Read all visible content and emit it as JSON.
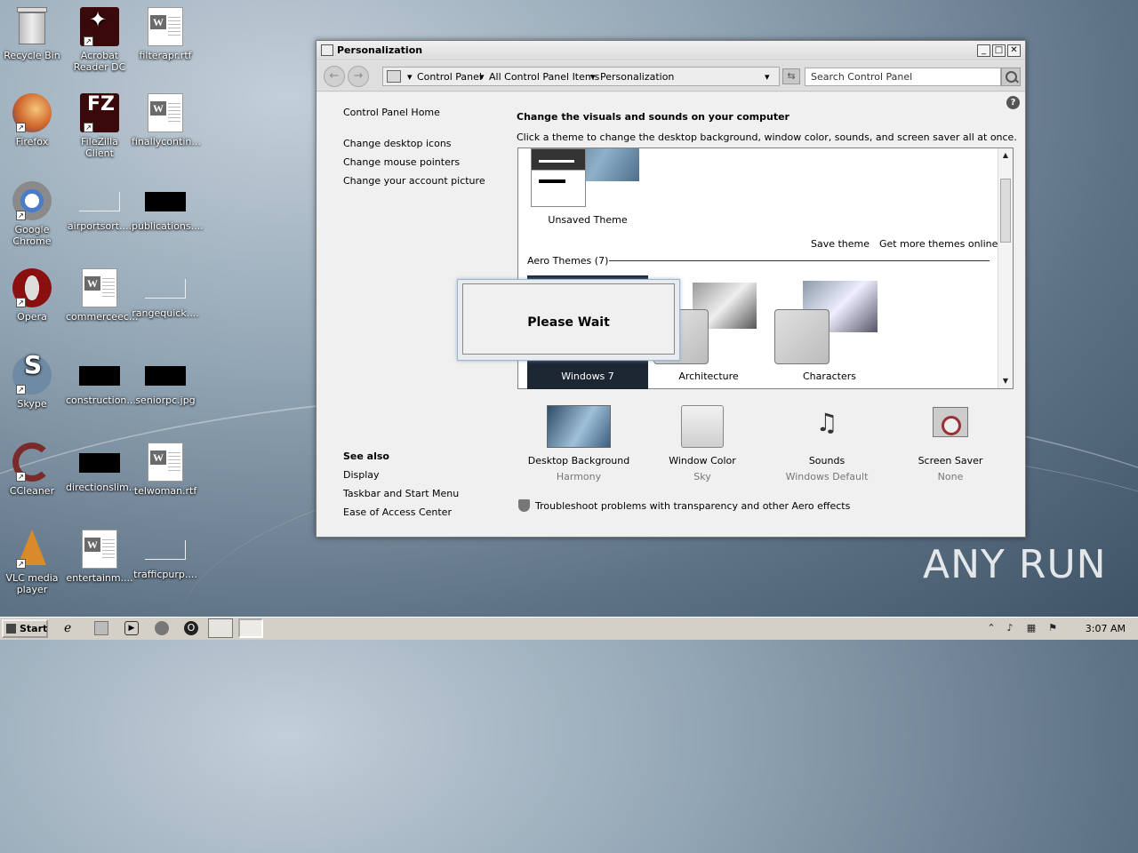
{
  "desktop": {
    "icons": [
      {
        "label": "Recycle Bin"
      },
      {
        "label": "Acrobat Reader DC"
      },
      {
        "label": "filterapr.rtf"
      },
      {
        "label": "Firefox"
      },
      {
        "label": "FileZilla Client"
      },
      {
        "label": "finallycontin..."
      },
      {
        "label": "Google Chrome"
      },
      {
        "label": "airportsort...."
      },
      {
        "label": "publications...."
      },
      {
        "label": "Opera"
      },
      {
        "label": "commerceec..."
      },
      {
        "label": "rangequick...."
      },
      {
        "label": "Skype"
      },
      {
        "label": "construction...."
      },
      {
        "label": "seniorpc.jpg"
      },
      {
        "label": "CCleaner"
      },
      {
        "label": "directionslim...."
      },
      {
        "label": "telwoman.rtf"
      },
      {
        "label": "VLC media player"
      },
      {
        "label": "entertainm...."
      },
      {
        "label": "trafficpurp...."
      }
    ]
  },
  "window": {
    "title": "Personalization",
    "breadcrumb": [
      "Control Panel",
      "All Control Panel Items",
      "Personalization"
    ],
    "search_placeholder": "Search Control Panel"
  },
  "left_nav": {
    "home": "Control Panel Home",
    "links": [
      "Change desktop icons",
      "Change mouse pointers",
      "Change your account picture"
    ],
    "see_also_title": "See also",
    "see_also": [
      "Display",
      "Taskbar and Start Menu",
      "Ease of Access Center"
    ]
  },
  "main": {
    "heading": "Change the visuals and sounds on your computer",
    "description": "Click a theme to change the desktop background, window color, sounds, and screen saver all at once.",
    "unsaved_theme": "Unsaved Theme",
    "save_theme": "Save theme",
    "get_more": "Get more themes online",
    "aero_group": "Aero Themes (7)",
    "themes": [
      "Windows 7",
      "Architecture",
      "Characters"
    ],
    "bottom": [
      {
        "label": "Desktop Background",
        "value": "Harmony"
      },
      {
        "label": "Window Color",
        "value": "Sky"
      },
      {
        "label": "Sounds",
        "value": "Windows Default"
      },
      {
        "label": "Screen Saver",
        "value": "None"
      }
    ],
    "troubleshoot": "Troubleshoot problems with transparency and other Aero effects"
  },
  "dialog": {
    "message": "Please Wait"
  },
  "taskbar": {
    "start": "Start",
    "clock": "3:07 AM"
  },
  "watermark": "ANY RUN"
}
